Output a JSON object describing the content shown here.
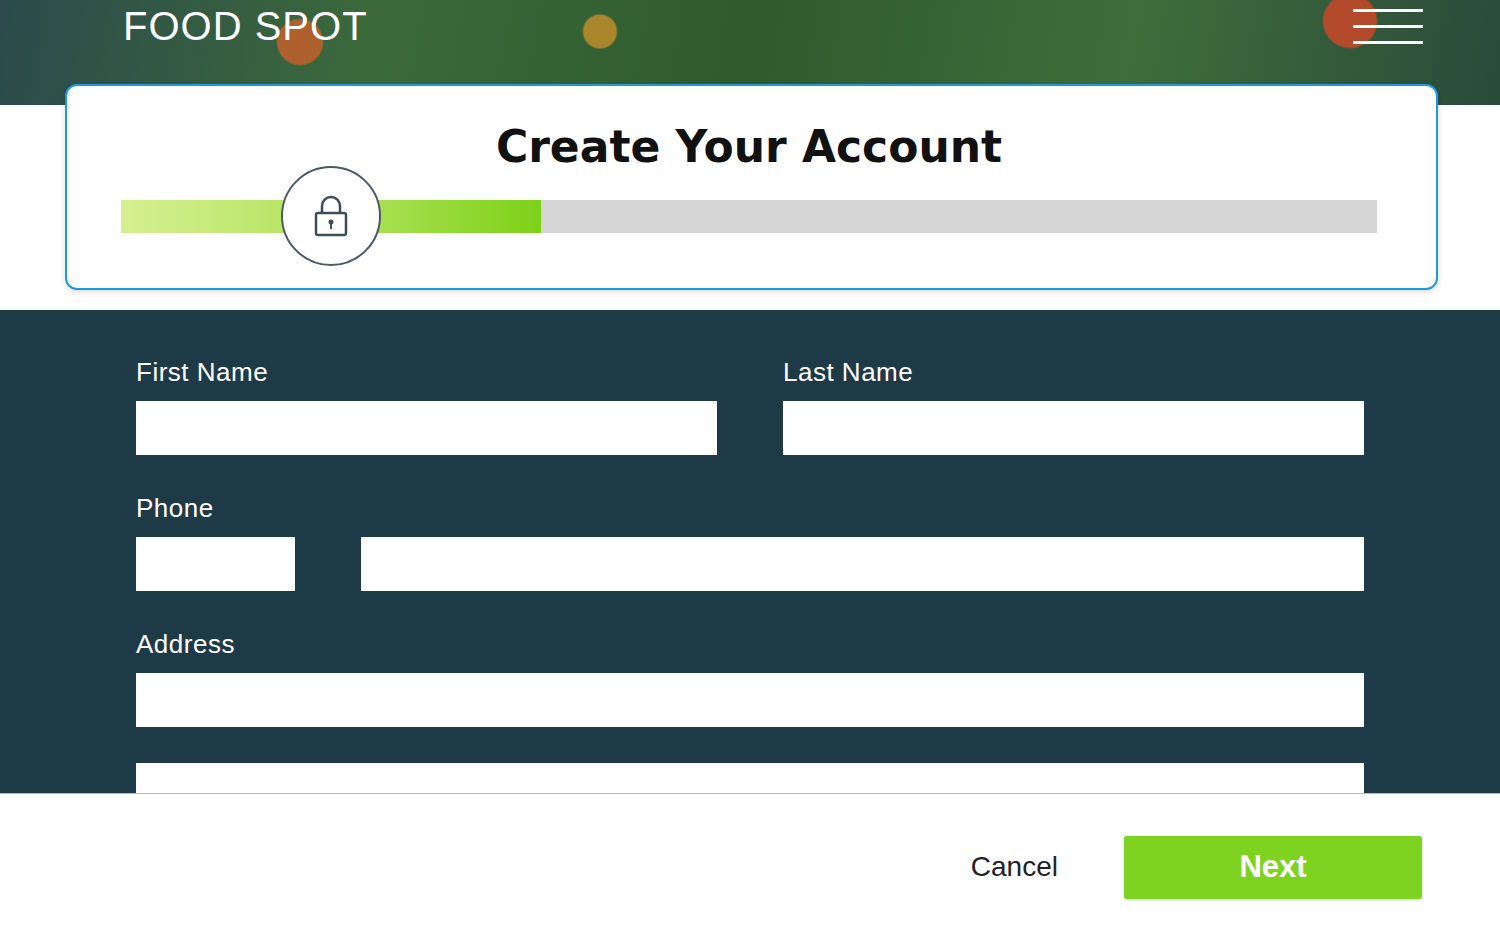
{
  "header": {
    "logo": "FOOD SPOT"
  },
  "card": {
    "title": "Create Your Account",
    "progress": {
      "level": 0.334
    }
  },
  "form": {
    "rows": [
      {
        "kind": "pair",
        "fields": [
          {
            "label": "First Name",
            "value": ""
          },
          {
            "label": "Last Name",
            "value": ""
          }
        ]
      },
      {
        "kind": "phone",
        "label": "Phone",
        "values": [
          "",
          ""
        ]
      },
      {
        "kind": "stack",
        "label": "Address",
        "values": [
          "",
          ""
        ]
      }
    ]
  },
  "buttons": [
    {
      "label": "Cancel",
      "kind": "link"
    },
    {
      "label": "Next",
      "kind": "primary"
    }
  ]
}
